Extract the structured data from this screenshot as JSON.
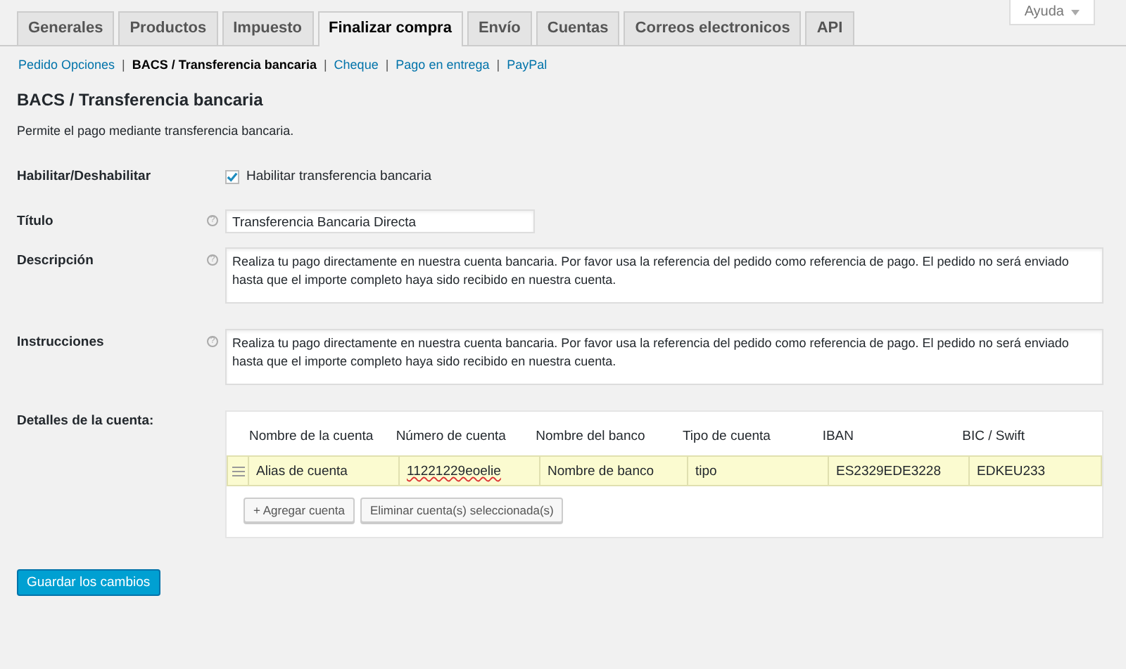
{
  "tabs": [
    {
      "label": "Generales",
      "selected": false
    },
    {
      "label": "Productos",
      "selected": false
    },
    {
      "label": "Impuesto",
      "selected": false
    },
    {
      "label": "Finalizar compra",
      "selected": true
    },
    {
      "label": "Envío",
      "selected": false
    },
    {
      "label": "Cuentas",
      "selected": false
    },
    {
      "label": "Correos electronicos",
      "selected": false
    },
    {
      "label": "API",
      "selected": false
    }
  ],
  "help_button": {
    "label": "Ayuda"
  },
  "subnav": [
    {
      "kind": "link",
      "label": "Pedido Opciones",
      "selected": false
    },
    {
      "kind": "separator",
      "label": "|"
    },
    {
      "kind": "link",
      "label": "BACS / Transferencia bancaria",
      "selected": true
    },
    {
      "kind": "separator",
      "label": "|"
    },
    {
      "kind": "link",
      "label": "Cheque",
      "selected": false
    },
    {
      "kind": "separator",
      "label": "|"
    },
    {
      "kind": "link",
      "label": "Pago en entrega",
      "selected": false
    },
    {
      "kind": "separator",
      "label": "|"
    },
    {
      "kind": "link",
      "label": "PayPal",
      "selected": false
    }
  ],
  "heading": "BACS / Transferencia bancaria",
  "description": "Permite el pago mediante transferencia bancaria.",
  "fields": [
    {
      "kind": "checkbox",
      "label": "Habilitar/Deshabilitar",
      "checked": true,
      "text": "Habilitar transferencia bancaria"
    },
    {
      "kind": "text",
      "label": "Título",
      "help": "?",
      "value": "Transferencia Bancaria Directa"
    },
    {
      "kind": "textarea",
      "label": "Descripción",
      "help": "?",
      "value": "Realiza tu pago directamente en nuestra cuenta bancaria. Por favor usa la referencia del pedido como referencia de pago. El pedido no será enviado hasta que el importe completo haya sido recibido en nuestra cuenta."
    },
    {
      "kind": "textarea",
      "label": "Instrucciones",
      "help": "?",
      "value": "Realiza tu pago directamente en nuestra cuenta bancaria. Por favor usa la referencia del pedido como referencia de pago. El pedido no será enviado hasta que el importe completo haya sido recibido en nuestra cuenta."
    },
    {
      "kind": "accounts",
      "label": "Detalles de la cuenta:"
    }
  ],
  "accounts": {
    "columns": [
      "Nombre de la cuenta",
      "Número de cuenta",
      "Nombre del banco",
      "Tipo de cuenta",
      "IBAN",
      "BIC / Swift"
    ],
    "rows": [
      {
        "selected": true,
        "cells": [
          "Alias de cuenta",
          "11221229eoelie",
          "Nombre de banco",
          "tipo",
          "ES2329EDE3228",
          "EDKEU233"
        ]
      }
    ],
    "buttons": [
      "+ Agregar cuenta",
      "Eliminar cuenta(s) seleccionada(s)"
    ]
  },
  "save_button": "Guardar los cambios"
}
